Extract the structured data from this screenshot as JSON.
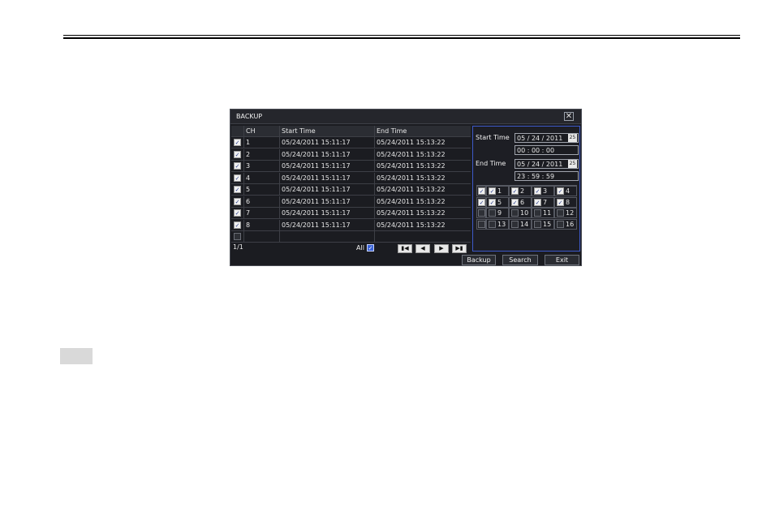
{
  "window": {
    "title": "BACKUP",
    "close_glyph": "✕"
  },
  "table": {
    "headers": [
      "CH",
      "Start Time",
      "End Time"
    ],
    "rows": [
      {
        "checked": true,
        "ch": "1",
        "start": "05/24/2011 15:11:17",
        "end": "05/24/2011 15:13:22"
      },
      {
        "checked": true,
        "ch": "2",
        "start": "05/24/2011 15:11:17",
        "end": "05/24/2011 15:13:22"
      },
      {
        "checked": true,
        "ch": "3",
        "start": "05/24/2011 15:11:17",
        "end": "05/24/2011 15:13:22"
      },
      {
        "checked": true,
        "ch": "4",
        "start": "05/24/2011 15:11:17",
        "end": "05/24/2011 15:13:22"
      },
      {
        "checked": true,
        "ch": "5",
        "start": "05/24/2011 15:11:17",
        "end": "05/24/2011 15:13:22"
      },
      {
        "checked": true,
        "ch": "6",
        "start": "05/24/2011 15:11:17",
        "end": "05/24/2011 15:13:22"
      },
      {
        "checked": true,
        "ch": "7",
        "start": "05/24/2011 15:11:17",
        "end": "05/24/2011 15:13:22"
      },
      {
        "checked": true,
        "ch": "8",
        "start": "05/24/2011 15:11:17",
        "end": "05/24/2011 15:13:22"
      },
      {
        "checked": false,
        "ch": "",
        "start": "",
        "end": ""
      }
    ]
  },
  "pager": {
    "page": "1/1",
    "all_label": "All",
    "all_checked": true,
    "nav": {
      "first": "first-page-icon",
      "prev": "prev-page-icon",
      "next": "next-page-icon",
      "last": "last-page-icon"
    }
  },
  "search": {
    "start_label": "Start Time",
    "start_date": "05 / 24 / 2011",
    "start_time": "00  :  00  :  00",
    "end_label": "End Time",
    "end_date": "05 / 24 / 2011",
    "end_time": "23  :  59  :  59",
    "calendar_icon_text": "25"
  },
  "channels": {
    "rows": [
      {
        "all_checked": true,
        "items": [
          {
            "n": "1",
            "checked": true
          },
          {
            "n": "2",
            "checked": true
          },
          {
            "n": "3",
            "checked": true
          },
          {
            "n": "4",
            "checked": true
          }
        ]
      },
      {
        "all_checked": true,
        "items": [
          {
            "n": "5",
            "checked": true
          },
          {
            "n": "6",
            "checked": true
          },
          {
            "n": "7",
            "checked": true
          },
          {
            "n": "8",
            "checked": true
          }
        ]
      },
      {
        "all_checked": false,
        "items": [
          {
            "n": "9",
            "checked": false
          },
          {
            "n": "10",
            "checked": false
          },
          {
            "n": "11",
            "checked": false
          },
          {
            "n": "12",
            "checked": false
          }
        ]
      },
      {
        "all_checked": false,
        "items": [
          {
            "n": "13",
            "checked": false
          },
          {
            "n": "14",
            "checked": false
          },
          {
            "n": "15",
            "checked": false
          },
          {
            "n": "16",
            "checked": false
          }
        ]
      }
    ]
  },
  "buttons": {
    "backup": "Backup",
    "search": "Search",
    "exit": "Exit"
  }
}
